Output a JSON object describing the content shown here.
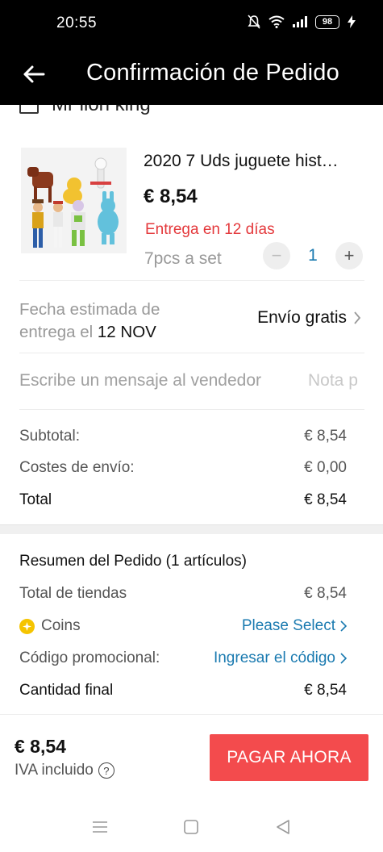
{
  "status_bar": {
    "time": "20:55",
    "battery": "98"
  },
  "header": {
    "title": "Confirmación de Pedido"
  },
  "store": {
    "name": "Mr lion king"
  },
  "product": {
    "name": "2020 7 Uds juguete hist…",
    "price": "€ 8,54",
    "delivery": "Entrega en 12 días",
    "variant": "7pcs a set",
    "quantity": "1"
  },
  "delivery": {
    "estimate_line1": "Fecha estimada de",
    "estimate_line2": "entrega el",
    "estimate_date": "12 NOV",
    "shipping": "Envío gratis"
  },
  "message": {
    "placeholder": "Escribe un mensaje al vendedor",
    "note": "Nota p"
  },
  "store_summary": {
    "subtotal_label": "Subtotal:",
    "subtotal_value": "€ 8,54",
    "shipping_label": "Costes de envío:",
    "shipping_value": "€ 0,00",
    "total_label": "Total",
    "total_value": "€ 8,54"
  },
  "order_summary": {
    "title": "Resumen del Pedido (1 artículos)",
    "stores_label": "Total de tiendas",
    "stores_value": "€ 8,54",
    "coins_label": "Coins",
    "coins_action": "Please Select",
    "promo_label": "Código promocional:",
    "promo_action": "Ingresar el código",
    "final_label": "Cantidad final",
    "final_value": "€ 8,54"
  },
  "checkout": {
    "total": "€ 8,54",
    "tax_note": "IVA incluido",
    "pay_label": "PAGAR AHORA"
  },
  "colors": {
    "accent_red": "#f34b4d",
    "link_blue": "#1a7ab0",
    "coin_yellow": "#f5c400"
  }
}
